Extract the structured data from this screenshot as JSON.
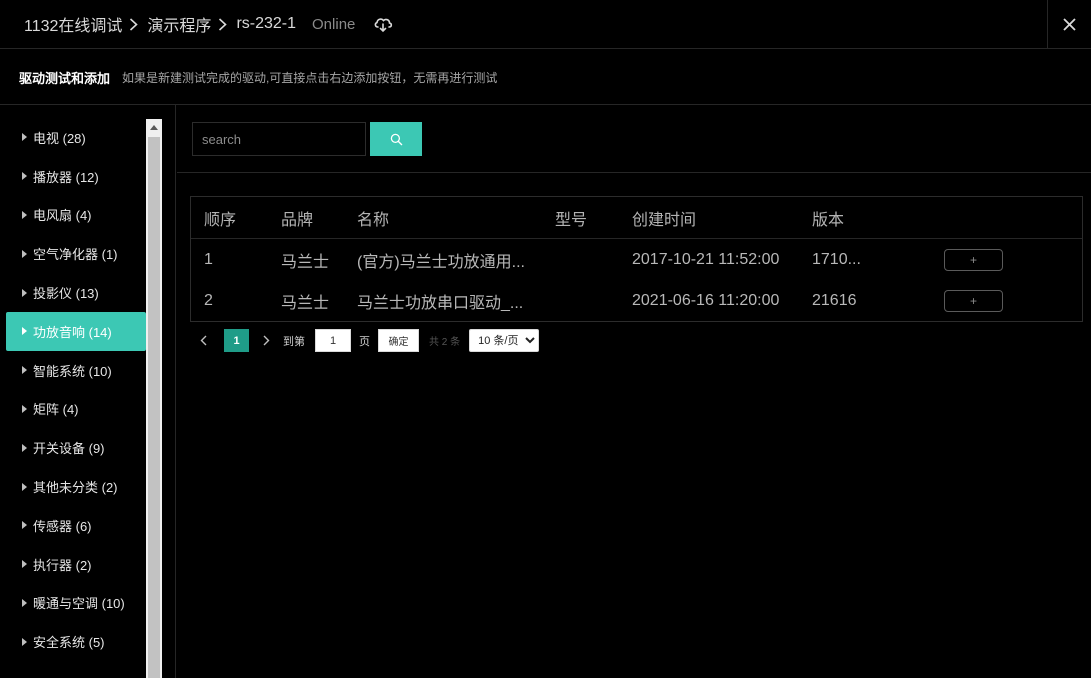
{
  "header": {
    "breadcrumbs": [
      "1132在线调试",
      "演示程序",
      "rs-232-1"
    ],
    "status": "Online",
    "cloud_icon": "cloud-sync-icon",
    "close_icon": "close-icon"
  },
  "subheader": {
    "title": "驱动测试和添加",
    "description": "如果是新建测试完成的驱动,可直接点击右边添加按钮，无需再进行测试"
  },
  "sidebar": {
    "active_index": 5,
    "items": [
      {
        "label": "电视 (28)"
      },
      {
        "label": "播放器 (12)"
      },
      {
        "label": "电风扇 (4)"
      },
      {
        "label": "空气净化器 (1)"
      },
      {
        "label": "投影仪 (13)"
      },
      {
        "label": "功放音响 (14)"
      },
      {
        "label": "智能系统 (10)"
      },
      {
        "label": "矩阵 (4)"
      },
      {
        "label": "开关设备 (9)"
      },
      {
        "label": "其他未分类 (2)"
      },
      {
        "label": "传感器 (6)"
      },
      {
        "label": "执行器 (2)"
      },
      {
        "label": "暖通与空调 (10)"
      },
      {
        "label": "安全系统 (5)"
      }
    ]
  },
  "search": {
    "placeholder": "search",
    "value": "",
    "button_icon": "search-icon"
  },
  "table": {
    "columns": [
      "顺序",
      "品牌",
      "名称",
      "型号",
      "创建时间",
      "版本"
    ],
    "rows": [
      {
        "order": "1",
        "brand": "马兰士",
        "name": "(官方)马兰士功放通用...",
        "model": "",
        "created": "2017-10-21 11:52:00",
        "version": "1710...",
        "action": "+"
      },
      {
        "order": "2",
        "brand": "马兰士",
        "name": "马兰士功放串口驱动_...",
        "model": "",
        "created": "2021-06-16 11:20:00",
        "version": "21616",
        "action": "+"
      }
    ]
  },
  "pagination": {
    "current_page": "1",
    "goto_label": "到第",
    "goto_value": "1",
    "page_unit": "页",
    "confirm_label": "确定",
    "total_label": "共 2 条",
    "page_size": "10 条/页",
    "accent_color": "#1f9c88"
  },
  "colors": {
    "accent": "#3cc8b4",
    "background": "#000000"
  }
}
